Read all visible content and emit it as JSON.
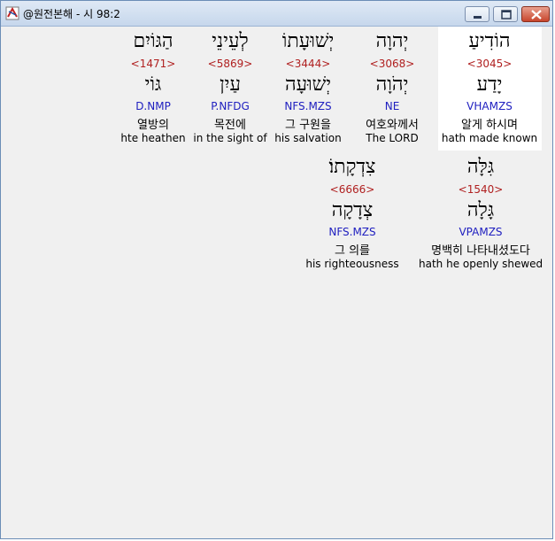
{
  "window": {
    "title": "@원전본해 - 시 98:2"
  },
  "colors": {
    "strong": "#b02020",
    "morph": "#2020c0",
    "selected_background": "#ffffff"
  },
  "words": [
    {
      "hebrew": "הוֹדִיעַ",
      "strong": "<3045>",
      "lemma": "יָדַע",
      "morph": "VHAMZS",
      "korean": "알게 하시며",
      "english": "hath made known"
    },
    {
      "hebrew": "יְהוָה",
      "strong": "<3068>",
      "lemma": "יְהֹוָה",
      "morph": "NE",
      "korean": "여호와께서",
      "english": "The LORD"
    },
    {
      "hebrew": "יְשׁוּעָתוֹ",
      "strong": "<3444>",
      "lemma": "יְשׁוּעָה",
      "morph": "NFS.MZS",
      "korean": "그 구원을",
      "english": "his salvation"
    },
    {
      "hebrew": "לְעֵינֵי",
      "strong": "<5869>",
      "lemma": "עַיִן",
      "morph": "P.NFDG",
      "korean": "목전에",
      "english": "in the sight of"
    },
    {
      "hebrew": "הַגּוֹיִם",
      "strong": "<1471>",
      "lemma": "גּוֹי",
      "morph": "D.NMP",
      "korean": "열방의",
      "english": "hte heathen"
    },
    {
      "hebrew": "גִּלָּה",
      "strong": "<1540>",
      "lemma": "גָּלָה",
      "morph": "VPAMZS",
      "korean": "명백히 나타내셨도다",
      "english": "hath he openly shewed"
    },
    {
      "hebrew": "צִדְקָתוֹ׃",
      "strong": "<6666>",
      "lemma": "צְדָקָה",
      "morph": "NFS.MZS",
      "korean": "그 의를",
      "english": "his righteousness"
    }
  ]
}
